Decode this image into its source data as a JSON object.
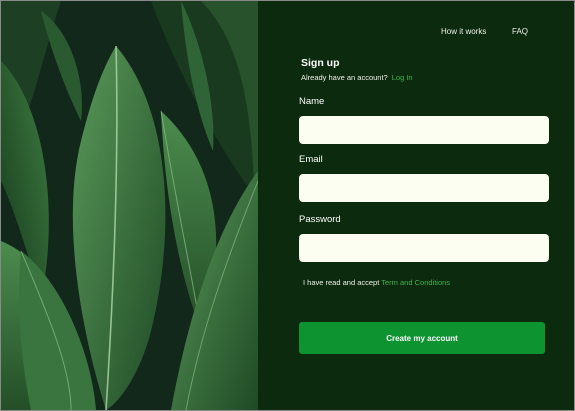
{
  "nav": {
    "how_it_works": "How it works",
    "faq": "FAQ"
  },
  "form": {
    "title": "Sign up",
    "already_text": "Already have an account?",
    "login_link": "Log In",
    "name_label": "Name",
    "name_value": "",
    "email_label": "Email",
    "email_value": "",
    "password_label": "Password",
    "password_value": "",
    "terms_prefix": "I have read and accept",
    "terms_link": "Term and Conditions",
    "submit_label": "Create my account"
  },
  "colors": {
    "panel_bg": "#0c2a0d",
    "accent": "#0d9330",
    "link": "#3fb34f",
    "field_bg": "#fdfef2"
  }
}
